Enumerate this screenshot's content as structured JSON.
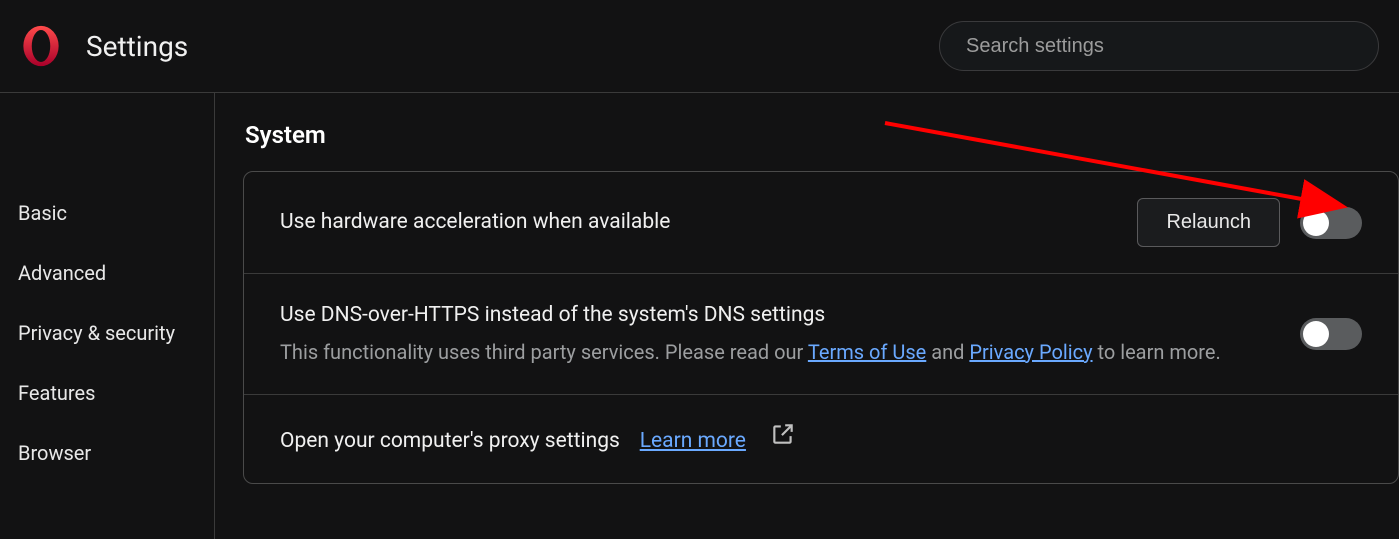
{
  "header": {
    "title": "Settings",
    "search_placeholder": "Search settings"
  },
  "sidebar": {
    "items": [
      {
        "label": "Basic"
      },
      {
        "label": "Advanced"
      },
      {
        "label": "Privacy & security"
      },
      {
        "label": "Features"
      },
      {
        "label": "Browser"
      }
    ]
  },
  "section": {
    "title": "System",
    "rows": {
      "hw_accel": {
        "title": "Use hardware acceleration when available",
        "button": "Relaunch",
        "toggle": false
      },
      "dns": {
        "title": "Use DNS-over-HTTPS instead of the system's DNS settings",
        "sub_a": "This functionality uses third party services. Please read our ",
        "terms": "Terms of Use",
        "sub_b": "  and  ",
        "privacy": "Privacy Policy",
        "sub_c": "  to learn more.",
        "toggle": false
      },
      "proxy": {
        "title": "Open your computer's proxy settings",
        "learn": "Learn more"
      }
    }
  }
}
